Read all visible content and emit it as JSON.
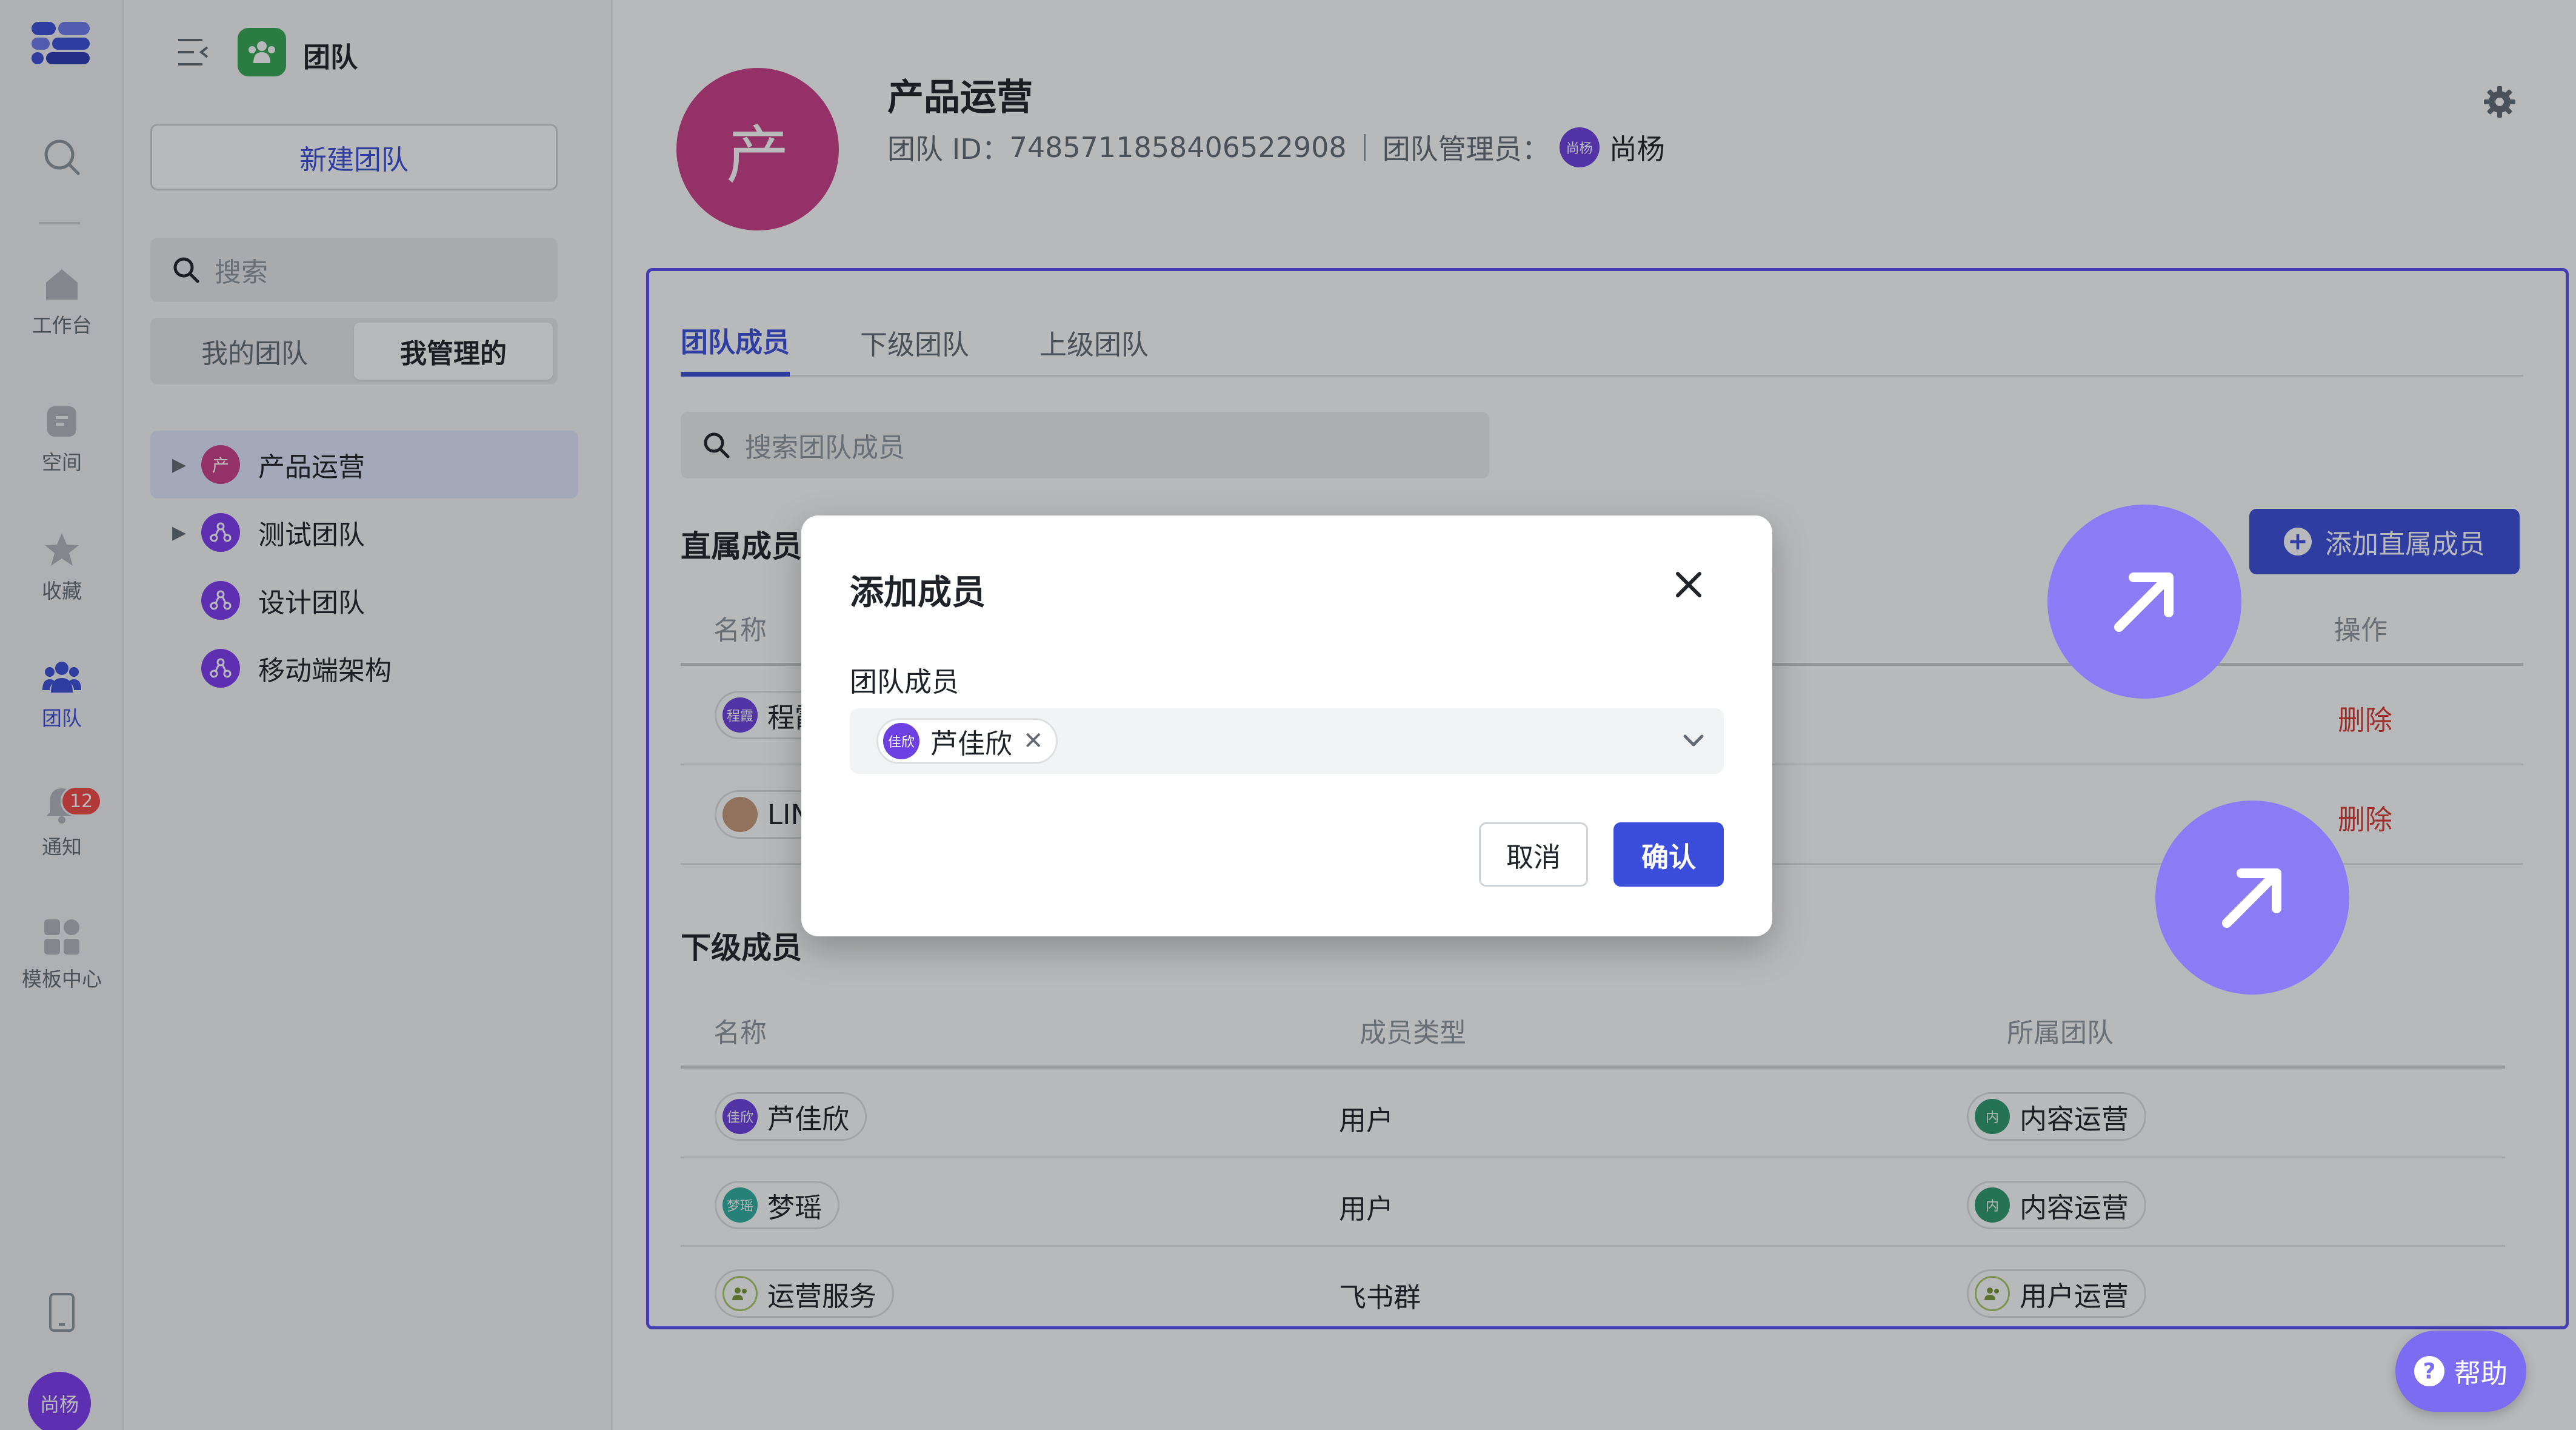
{
  "rail": {
    "items": [
      {
        "label": ""
      },
      {
        "label": "工作台"
      },
      {
        "label": "空间"
      },
      {
        "label": "收藏"
      },
      {
        "label": "团队"
      },
      {
        "label": "通知"
      },
      {
        "label": "模板中心"
      }
    ],
    "notification_badge": "12",
    "user_avatar": "尚杨"
  },
  "sidebar": {
    "title": "团队",
    "new_team_button": "新建团队",
    "search_placeholder": "搜索",
    "segments": [
      "我的团队",
      "我管理的"
    ],
    "teams": [
      {
        "label": "产品运营",
        "avatar": "产",
        "color": "#cc3e8a",
        "expandable": true
      },
      {
        "label": "测试团队",
        "avatar": "",
        "color": "#7e3bf2",
        "expandable": true
      },
      {
        "label": "设计团队",
        "avatar": "",
        "color": "#7e3bf2",
        "expandable": false
      },
      {
        "label": "移动端架构",
        "avatar": "",
        "color": "#7e3bf2",
        "expandable": false
      }
    ]
  },
  "team": {
    "avatar": "产",
    "name": "产品运营",
    "id_label": "团队 ID：",
    "id_value": "7485711858406522908",
    "admin_label": "团队管理员：",
    "admin_avatar": "尚杨",
    "admin_name": "尚杨"
  },
  "tabs": [
    "团队成员",
    "下级团队",
    "上级团队"
  ],
  "member_search_placeholder": "搜索团队成员",
  "direct": {
    "title": "直属成员",
    "add_button": "添加直属成员",
    "col_name": "名称",
    "col_action": "操作",
    "rows": [
      {
        "avatar": "程霞",
        "name": "程霞",
        "action": "删除"
      },
      {
        "avatar": "",
        "name": "LIN",
        "action": "删除"
      }
    ]
  },
  "sub": {
    "title": "下级成员",
    "columns": [
      "名称",
      "成员类型",
      "所属团队"
    ],
    "rows": [
      {
        "avatar": "佳欣",
        "name": "芦佳欣",
        "type": "用户",
        "team_avatar": "内",
        "team": "内容运营"
      },
      {
        "avatar": "梦瑶",
        "name": "梦瑶",
        "type": "用户",
        "team_avatar": "内",
        "team": "内容运营"
      },
      {
        "avatar": "",
        "name": "运营服务",
        "type": "飞书群",
        "team_avatar": "",
        "team": "用户运营"
      }
    ]
  },
  "modal": {
    "title": "添加成员",
    "field_label": "团队成员",
    "selected": [
      {
        "avatar": "佳欣",
        "name": "芦佳欣"
      }
    ],
    "cancel": "取消",
    "confirm": "确认"
  },
  "help_button": "帮助",
  "colors": {
    "accent": "#3b4edb",
    "danger": "#d83931",
    "team_avatar": "#cc3e8a",
    "bubble": "#8b7cf6"
  }
}
